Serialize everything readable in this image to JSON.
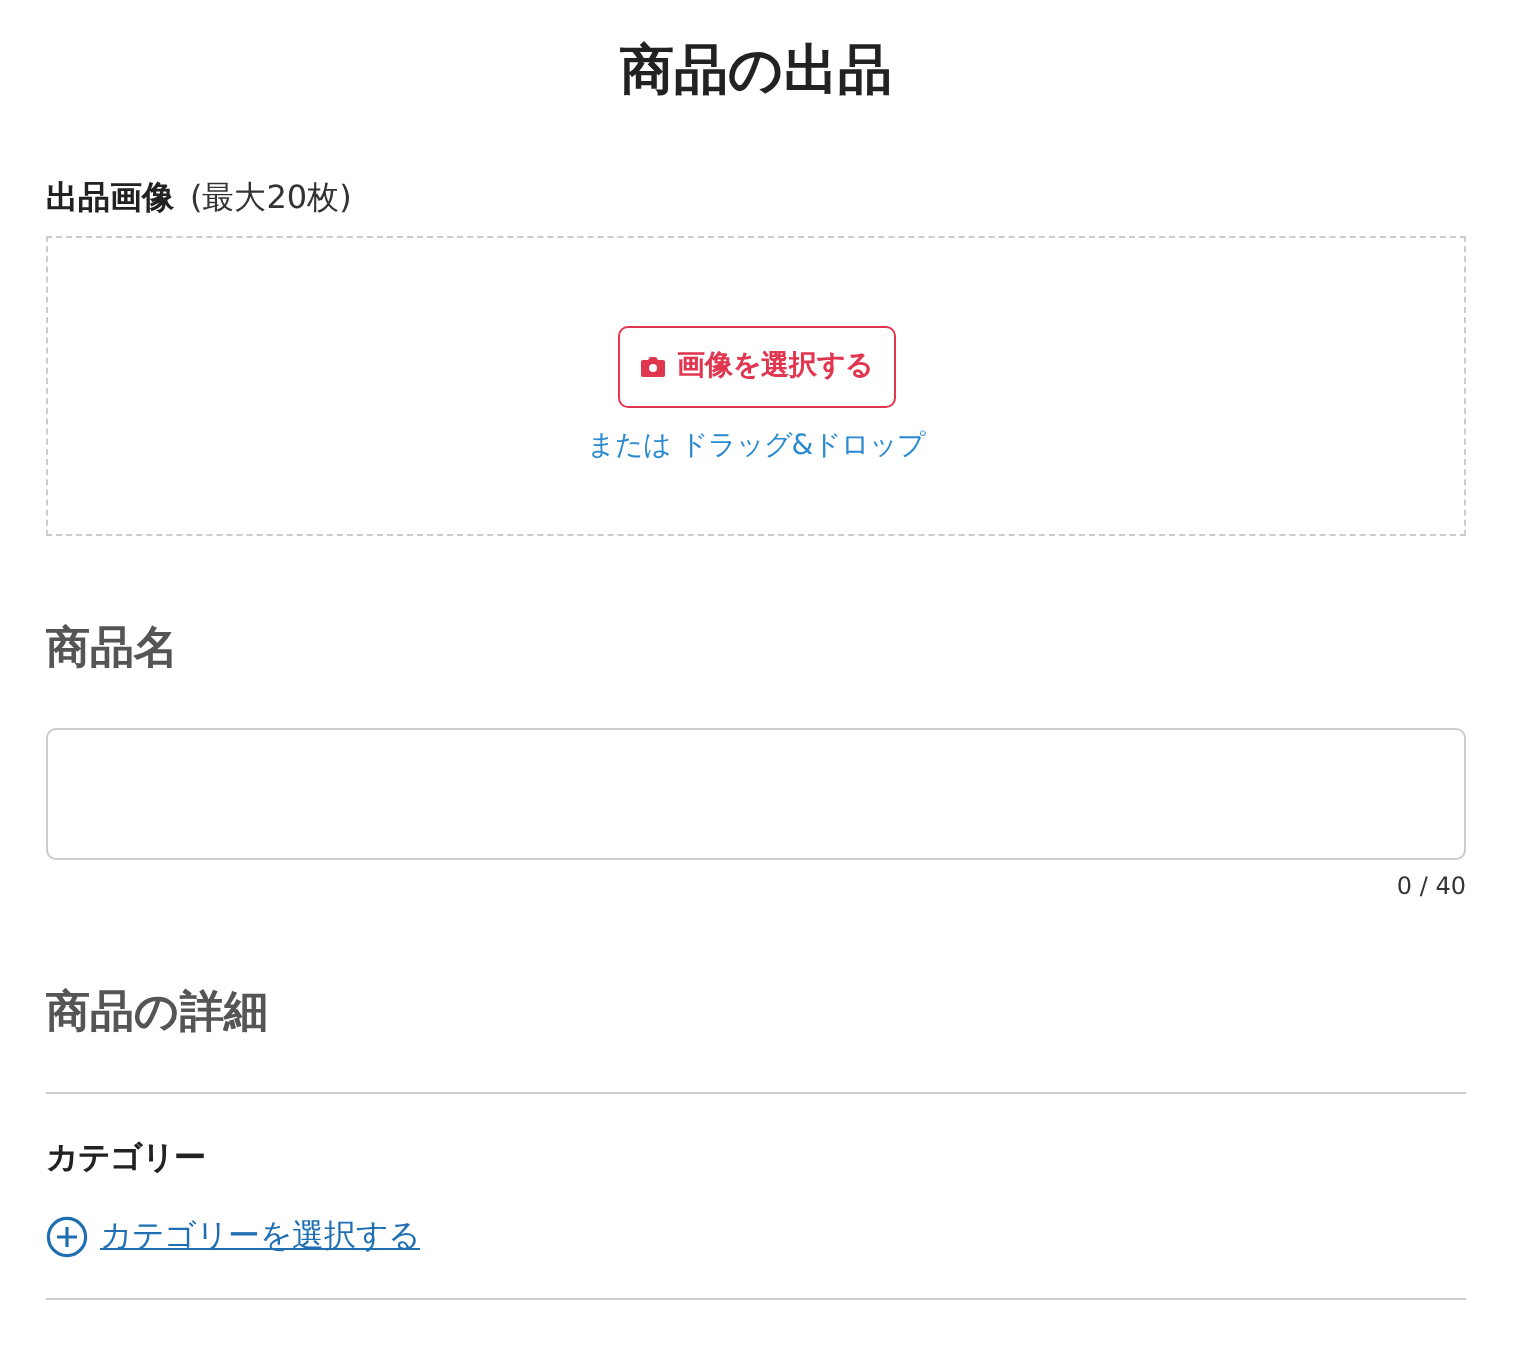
{
  "page_title": "商品の出品",
  "image_upload": {
    "label": "出品画像",
    "note": "(最大20枚)",
    "button": "画像を選択する",
    "drop_hint": "または ドラッグ&ドロップ"
  },
  "name_section": {
    "heading": "商品名",
    "counter": "0 / 40"
  },
  "details_section": {
    "heading": "商品の詳細",
    "category_label": "カテゴリー",
    "category_link": "カテゴリーを選択する"
  }
}
